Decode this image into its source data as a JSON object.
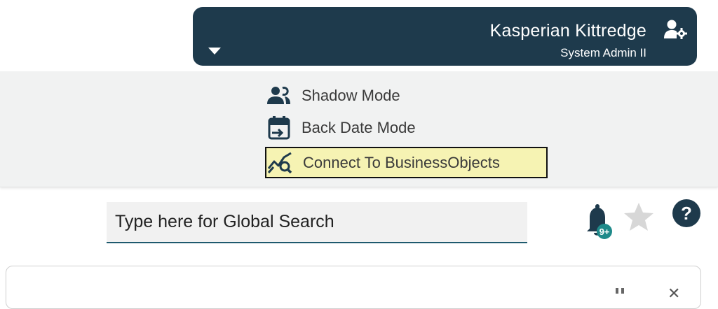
{
  "user": {
    "name": "Kasperian Kittredge",
    "role": "System Admin II",
    "icon": "user-gear-icon"
  },
  "menu": {
    "items": [
      {
        "label": "Shadow Mode",
        "icon": "users-icon"
      },
      {
        "label": "Back Date Mode",
        "icon": "calendar-back-icon"
      },
      {
        "label": "Connect To BusinessObjects",
        "icon": "chart-search-icon",
        "highlighted": true
      }
    ]
  },
  "search": {
    "placeholder": "Type here for Global Search"
  },
  "notifications": {
    "badge": "9+"
  },
  "colors": {
    "header_bg": "#1e3a4c",
    "panel_bg": "#f1f2f2",
    "highlight": "#f6f3b3",
    "accent": "#1e5a6e"
  }
}
